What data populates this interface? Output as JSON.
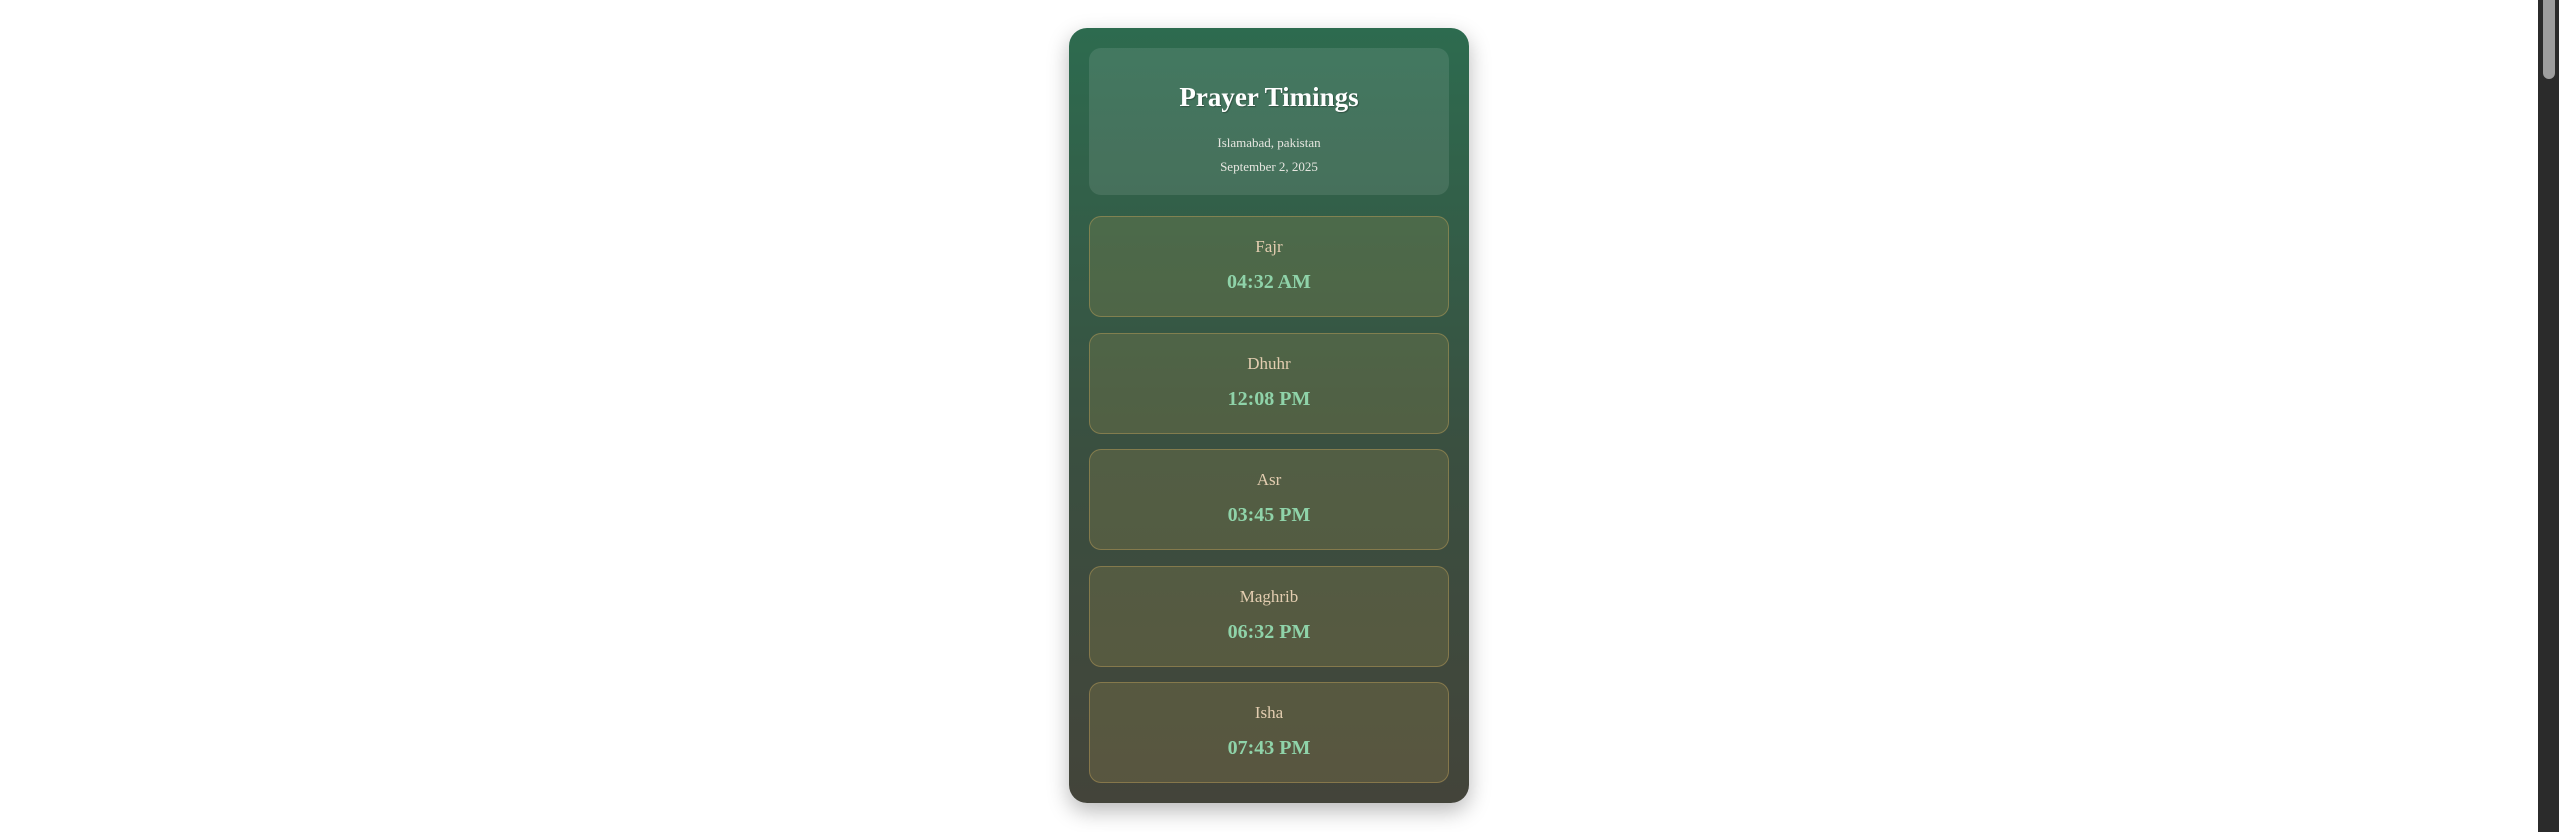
{
  "header": {
    "title": "Prayer Timings",
    "location": "Islamabad, pakistan",
    "date": "September 2, 2025"
  },
  "prayers": [
    {
      "name": "Fajr",
      "time": "04:32 AM"
    },
    {
      "name": "Dhuhr",
      "time": "12:08 PM"
    },
    {
      "name": "Asr",
      "time": "03:45 PM"
    },
    {
      "name": "Maghrib",
      "time": "06:32 PM"
    },
    {
      "name": "Isha",
      "time": "07:43 PM"
    }
  ],
  "colors": {
    "card_top": "#2d6b4f",
    "card_bottom": "#43443a",
    "time": "#8fd3a9",
    "name": "#e3cdb0"
  }
}
